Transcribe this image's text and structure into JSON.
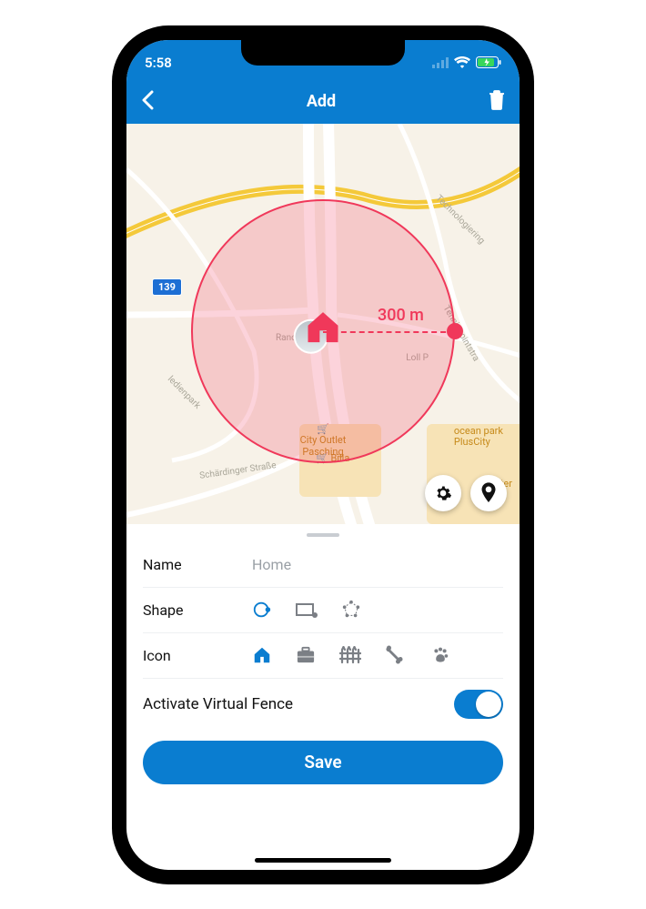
{
  "status": {
    "time": "5:58"
  },
  "nav": {
    "title": "Add"
  },
  "map": {
    "radius_label": "300 m",
    "route_badge": "139",
    "labels": {
      "l1": "Randlst",
      "l2": "ledienpark",
      "l3": "Schärdinger Straße",
      "l4": "Technologiering",
      "l5": "Tennispointstra",
      "l6": "Loll P"
    },
    "poi": {
      "p1": "City Outlet\nPasching",
      "p2": "Billa",
      "p3": "ocean park\nPlusCity",
      "p4": "Inter"
    }
  },
  "form": {
    "name_label": "Name",
    "name_placeholder": "Home",
    "shape_label": "Shape",
    "icon_label": "Icon",
    "activate_label": "Activate Virtual Fence",
    "save_label": "Save"
  }
}
